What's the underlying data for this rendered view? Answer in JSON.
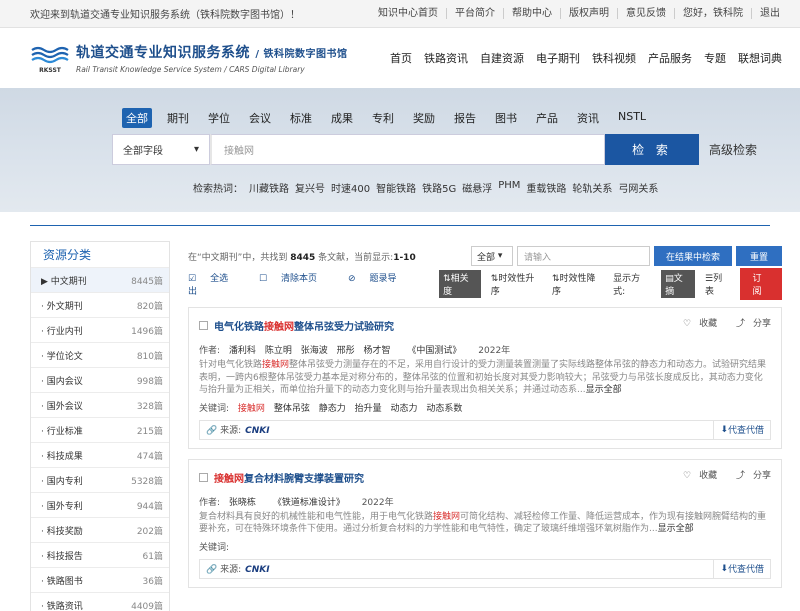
{
  "topbar": {
    "welcome": "欢迎来到轨道交通专业知识服务系统（铁科院数字图书馆）！",
    "links": [
      "知识中心首页",
      "平台简介",
      "帮助中心",
      "版权声明",
      "意见反馈",
      "您好，铁科院",
      "退出"
    ]
  },
  "header": {
    "logo_text": "RKSST",
    "title": "轨道交通专业知识服务系统",
    "title_suffix": "/ 铁科院数字图书馆",
    "subtitle": "Rail Transit Knowledge Service System / CARS Digital Library",
    "nav": [
      "首页",
      "铁路资讯",
      "自建资源",
      "电子期刊",
      "铁科视频",
      "产品服务",
      "专题",
      "联想词典"
    ]
  },
  "search": {
    "tabs": [
      "全部",
      "期刊",
      "学位",
      "会议",
      "标准",
      "成果",
      "专利",
      "奖励",
      "报告",
      "图书",
      "产品",
      "资讯",
      "NSTL"
    ],
    "field": "全部字段",
    "query": "接触网",
    "button": "检 索",
    "advanced": "高级检索",
    "hot_label": "检索热词：",
    "hot_terms": [
      "川藏铁路",
      "复兴号",
      "时速400",
      "智能铁路",
      "铁路5G",
      "磁悬浮",
      "PHM",
      "重载铁路",
      "轮轨关系",
      "弓网关系"
    ]
  },
  "sidebar": {
    "title": "资源分类",
    "items": [
      {
        "label": "▶ 中文期刊",
        "count": "8445篇"
      },
      {
        "label": "· 外文期刊",
        "count": "820篇"
      },
      {
        "label": "· 行业内刊",
        "count": "1496篇"
      },
      {
        "label": "· 学位论文",
        "count": "810篇"
      },
      {
        "label": "· 国内会议",
        "count": "998篇"
      },
      {
        "label": "· 国外会议",
        "count": "328篇"
      },
      {
        "label": "· 行业标准",
        "count": "215篇"
      },
      {
        "label": "· 科技成果",
        "count": "474篇"
      },
      {
        "label": "· 国内专利",
        "count": "5328篇"
      },
      {
        "label": "· 国外专利",
        "count": "944篇"
      },
      {
        "label": "· 科技奖励",
        "count": "202篇"
      },
      {
        "label": "· 科技报告",
        "count": "61篇"
      },
      {
        "label": "· 铁路图书",
        "count": "36篇"
      },
      {
        "label": "· 铁路资讯",
        "count": "4409篇"
      }
    ]
  },
  "results": {
    "summary_pre": "在“中文期刊”中，共找到",
    "total": "8445",
    "summary_mid": "条文献，当前显示:",
    "range": "1-10",
    "filter_sel": "全部",
    "filter_placeholder": "请输入",
    "in_result_btn": "在结果中检索",
    "reset_btn": "重置",
    "select_all": "全选",
    "clear_page": "清除本页",
    "export": "题录导出",
    "sort": [
      "相关度",
      "时效性升序",
      "时效性降序"
    ],
    "display_label": "显示方式:",
    "display": [
      "文摘",
      "列表"
    ],
    "order_btn": "订阅"
  },
  "cards": [
    {
      "title_pre": "电气化铁路",
      "title_hl": "接触网",
      "title_post": "整体吊弦受力试验研究",
      "collect": "收藏",
      "share": "分享",
      "authors_label": "作者:",
      "authors": [
        "潘利科",
        "陈立明",
        "张海波",
        "邢彤",
        "杨才智"
      ],
      "journal": "《中国测试》",
      "year": "2022年",
      "abstract_pre": "针对电气化铁路",
      "abstract_hl": "接触网",
      "abstract_post": "整体吊弦受力测量存在的不足，采用自行设计的受力测量装置测量了实际线路整体吊弦的静态力和动态力。试验研究结果表明，一跨内6根整体吊弦受力基本是对称分布的，整体吊弦的位置和初始长度对其受力影响较大；吊弦受力与吊弦长度成反比，其动态力变化与抬升量为正相关，而单位抬升量下的动态力变化则与抬升量表现出负相关关系；并通过动态系...",
      "show_all": "显示全部",
      "keywords_label": "关键词:",
      "keywords": [
        "接触网",
        "整体吊弦",
        "静态力",
        "抬升量",
        "动态力",
        "动态系数"
      ],
      "source_label": "来源:",
      "source": "CNKI",
      "download": "代查代借"
    },
    {
      "title_pre": "",
      "title_hl": "接触网",
      "title_post": "复合材料腕臂支撑装置研究",
      "collect": "收藏",
      "share": "分享",
      "authors_label": "作者:",
      "authors": [
        "张晓栋"
      ],
      "journal": "《铁道标准设计》",
      "year": "2022年",
      "abstract_pre": "复合材料具有良好的机械性能和电气性能，用于电气化铁路",
      "abstract_hl": "接触网",
      "abstract_post": "可简化结构、减轻检修工作量、降低运营成本，作为现有接触网腕臂结构的重要补充，可在特殊环境条件下使用。通过分析复合材料的力学性能和电气特性，确定了玻璃纤维增强环氧树脂作为...",
      "show_all": "显示全部",
      "keywords_label": "关键词:",
      "keywords": [],
      "source_label": "来源:",
      "source": "CNKI",
      "download": "代查代借"
    }
  ]
}
